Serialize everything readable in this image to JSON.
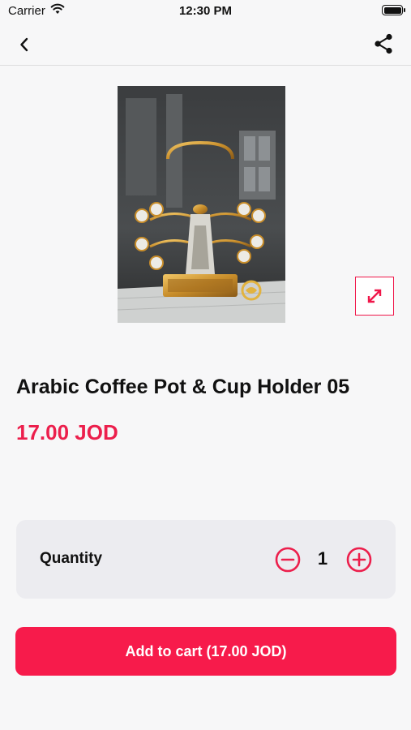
{
  "status_bar": {
    "carrier": "Carrier",
    "time": "12:30 PM"
  },
  "nav": {
    "back_icon": "chevron-left-icon",
    "share_icon": "share-icon"
  },
  "product": {
    "title": "Arabic Coffee Pot & Cup Holder 05",
    "price": "17.00 JOD",
    "expand_icon": "expand-arrows-icon"
  },
  "quantity": {
    "label": "Quantity",
    "value": "1",
    "minus_icon": "minus-circle-icon",
    "plus_icon": "plus-circle-icon"
  },
  "cart_button": {
    "label": "Add to cart (17.00 JOD)"
  },
  "colors": {
    "accent": "#f71b4b",
    "price": "#ec1f4c",
    "card": "#ececf0",
    "background": "#f7f7f8"
  }
}
